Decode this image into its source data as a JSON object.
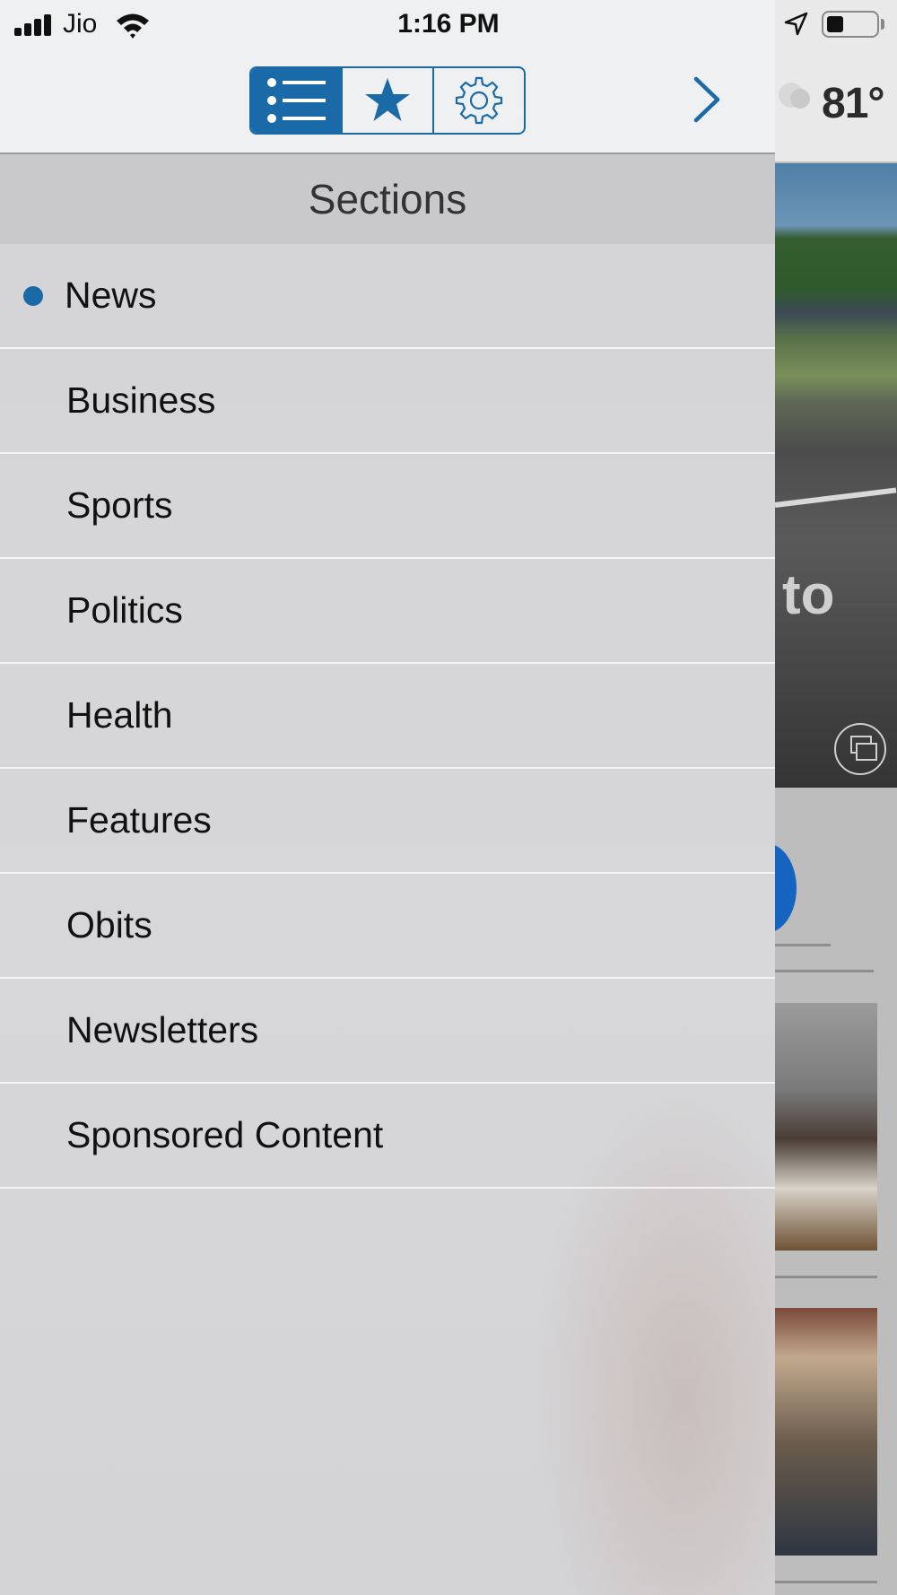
{
  "status_bar": {
    "carrier": "Jio",
    "time": "1:16 PM",
    "battery_level": 0.35
  },
  "background_app": {
    "weather_temp": "81°",
    "hero_text": "to"
  },
  "toolbar": {
    "tabs": [
      {
        "icon": "list-icon",
        "active": true
      },
      {
        "icon": "star-icon",
        "active": false
      },
      {
        "icon": "gear-icon",
        "active": false
      }
    ],
    "close_icon": "chevron-right-icon",
    "accent_color": "#1a6aa8"
  },
  "sections": {
    "title": "Sections",
    "items": [
      {
        "label": "News",
        "selected": true
      },
      {
        "label": "Business",
        "selected": false
      },
      {
        "label": "Sports",
        "selected": false
      },
      {
        "label": "Politics",
        "selected": false
      },
      {
        "label": "Health",
        "selected": false
      },
      {
        "label": "Features",
        "selected": false
      },
      {
        "label": "Obits",
        "selected": false
      },
      {
        "label": "Newsletters",
        "selected": false
      },
      {
        "label": "Sponsored Content",
        "selected": false
      }
    ]
  }
}
